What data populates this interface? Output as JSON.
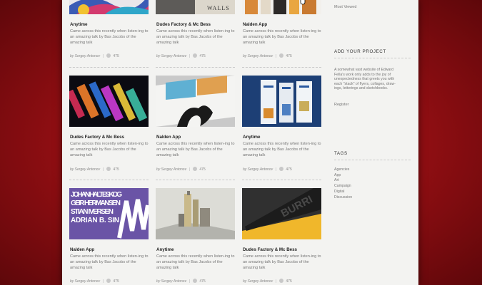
{
  "cards": [
    {
      "title": "Anytime",
      "description": "Came across this recently when listen-ing to an amazing talk by Bas Jacobs of the amazing talk",
      "author": "by  Sergey Antonov",
      "comments": "475"
    },
    {
      "title": "Dudes Factory & Mc Bess",
      "description": "Came across this recently when listen-ing to an amazing talk by Bas Jacobs of the amazing talk",
      "author": "by  Sergey Antonov",
      "comments": "475"
    },
    {
      "title": "Nalden App",
      "description": "Came across this recently when listen-ing to an amazing talk by Bas Jacobs of the amazing talk",
      "author": "by  Sergey Antonov",
      "comments": "475"
    },
    {
      "title": "Dudes Factory & Mc Bess",
      "description": "Came across this recently when listen-ing to an amazing talk by Bas Jacobs of the amazing talk",
      "author": "by  Sergey Antonov",
      "comments": "475"
    },
    {
      "title": "Nalden App",
      "description": "Came across this recently when listen-ing to an amazing talk by Bas Jacobs of the amazing talk",
      "author": "by  Sergey Antonov",
      "comments": "475"
    },
    {
      "title": "Anytime",
      "description": "Came across this recently when listen-ing to an amazing talk by Bas Jacobs of the amazing talk",
      "author": "by  Sergey Antonov",
      "comments": "475"
    },
    {
      "title": "Nalden App",
      "description": "Came across this recently when listen-ing to an amazing talk by Bas Jacobs of the amazing talk",
      "author": "by  Sergey Antonov",
      "comments": "475"
    },
    {
      "title": "Anytime",
      "description": "Came across this recently when listen-ing to an amazing talk by Bas Jacobs of the amazing talk",
      "author": "by  Sergey Antonov",
      "comments": "475"
    },
    {
      "title": "Dudes Factory & Mc Bess",
      "description": "Came across this recently when listen-ing to an amazing talk by Bas Jacobs of the amazing talk",
      "author": "by  Sergey Antonov",
      "comments": "475"
    }
  ],
  "sidebar": {
    "most_viewed": "Most Viewed",
    "add_project": {
      "heading": "ADD YOUR PROJECT",
      "text": "A somewhat vast website of Edward Fella's work only adds to the joy of unexpectedness that greets you with each \"stack\" of flyers, collages, draw-ings, letterings and sketchbooks.",
      "register": "Register"
    },
    "tags": {
      "heading": "TAGS",
      "items": [
        "Agencies",
        "App",
        "Art",
        "Campaign",
        "Digital",
        "Discussion"
      ]
    }
  },
  "thumbnails": [
    {
      "alt": "colorful swirl artwork"
    },
    {
      "alt": "book with walls lettering"
    },
    {
      "alt": "product packaging bottles"
    },
    {
      "alt": "dark city lights poster"
    },
    {
      "alt": "open book with ink illustration"
    },
    {
      "alt": "blue branded packaging"
    },
    {
      "alt": "purple typography poster",
      "text": "JOHAN HALTESKOG GEIR HERMANSEN STIAN IVERSEN ADRIAN B. SIN"
    },
    {
      "alt": "industrial tower photo"
    },
    {
      "alt": "black and yellow book",
      "text": "BURRI"
    }
  ]
}
